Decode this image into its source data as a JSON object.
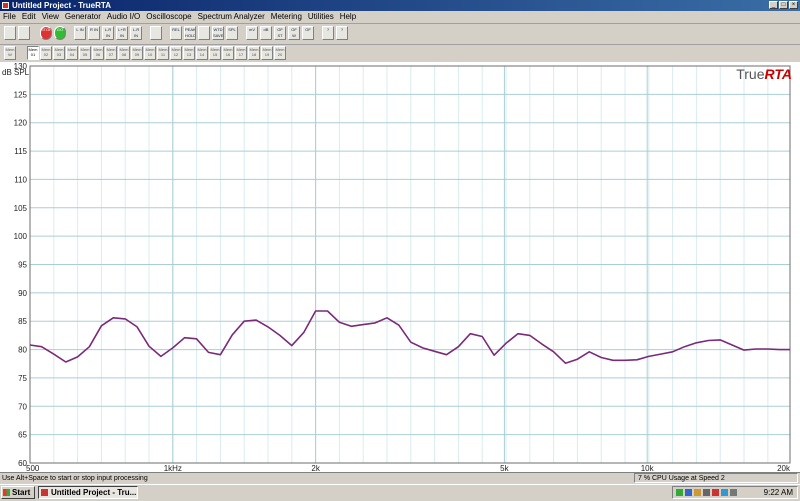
{
  "window": {
    "title": "Untitled Project - TrueRTA"
  },
  "menu": [
    "File",
    "Edit",
    "View",
    "Generator",
    "Audio I/O",
    "Oscilloscope",
    "Spectrum Analyzer",
    "Metering",
    "Utilities",
    "Help"
  ],
  "toolbar": [
    {
      "name": "sine-wave-tool",
      "label": ""
    },
    {
      "name": "spectrum-tool",
      "label": ""
    },
    {
      "name": "stop-tool",
      "label": "STOP"
    },
    {
      "name": "go-tool",
      "label": "GO"
    },
    {
      "name": "left-in-tool",
      "label": "L IN"
    },
    {
      "name": "right-in-tool",
      "label": "R IN"
    },
    {
      "name": "lr-in-tool",
      "label": "L-R IN"
    },
    {
      "name": "lplusr-in-tool",
      "label": "L+R IN"
    },
    {
      "name": "l-r-in-tool",
      "label": "L-R IN"
    },
    {
      "name": "grid-tool",
      "label": ""
    },
    {
      "name": "rel-tool",
      "label": "REL"
    },
    {
      "name": "peak-hold-tool",
      "label": "PEAK HOLD"
    },
    {
      "name": "bars-tool",
      "label": ""
    },
    {
      "name": "wtd-tool",
      "label": "WTD SAVE"
    },
    {
      "name": "spl-tool",
      "label": "SPL"
    },
    {
      "name": "mv-tool",
      "label": "mV"
    },
    {
      "name": "db-tool",
      "label": "dB"
    },
    {
      "name": "ofs-tool",
      "label": "OF ST"
    },
    {
      "name": "ofw-tool",
      "label": "OF W"
    },
    {
      "name": "of-tool",
      "label": "OF"
    },
    {
      "name": "info-tool",
      "label": "?"
    },
    {
      "name": "help-tool",
      "label": "?"
    }
  ],
  "memory_buttons": [
    "Mem W",
    "Mem 01",
    "Mem 02",
    "Mem 03",
    "Mem 04",
    "Mem 05",
    "Mem 06",
    "Mem 07",
    "Mem 08",
    "Mem 09",
    "Mem 10",
    "Mem 11",
    "Mem 12",
    "Mem 13",
    "Mem 14",
    "Mem 15",
    "Mem 16",
    "Mem 17",
    "Mem 18",
    "Mem 19",
    "Mem 20"
  ],
  "brand": {
    "part1": "True",
    "part2": "RTA"
  },
  "status": {
    "hint": "Use Alt+Space to start or stop input processing",
    "cpu": "7 % CPU Usage at Speed 2"
  },
  "taskbar": {
    "start": "Start",
    "task": "Untitled Project - Tru...",
    "clock": "9:22 AM"
  },
  "colors": {
    "trace": "#7a2a7a",
    "grid_major": "#a9cfd4",
    "grid_minor": "#d9ecee"
  },
  "chart_data": {
    "type": "line",
    "ylabel": "dB SPL",
    "ylim": [
      60,
      130
    ],
    "yticks": [
      60,
      65,
      70,
      75,
      80,
      85,
      90,
      95,
      100,
      105,
      110,
      115,
      120,
      125,
      130
    ],
    "xscale": "log",
    "xlim": [
      500,
      20000
    ],
    "xtick_labels": [
      {
        "freq": 500,
        "label": "500"
      },
      {
        "freq": 1000,
        "label": "1kHz"
      },
      {
        "freq": 2000,
        "label": "2k"
      },
      {
        "freq": 5000,
        "label": "5k"
      },
      {
        "freq": 10000,
        "label": "10k"
      },
      {
        "freq": 20000,
        "label": "20k"
      }
    ],
    "grid": true,
    "series": [
      {
        "x": [
          500,
          529,
          561,
          595,
          630,
          667,
          707,
          749,
          794,
          841,
          891,
          944,
          1000,
          1059,
          1122,
          1189,
          1260,
          1335,
          1414,
          1498,
          1587,
          1682,
          1782,
          1888,
          2000,
          2119,
          2245,
          2378,
          2520,
          2670,
          2828,
          2997,
          3175,
          3364,
          3564,
          3776,
          4000,
          4238,
          4490,
          4757,
          5040,
          5339,
          5657,
          5993,
          6350,
          6727,
          7127,
          7551,
          8000,
          8476,
          8980,
          9514,
          10079,
          10679,
          11314,
          11986,
          12699,
          13454,
          14254,
          15102,
          16000,
          16951,
          17959,
          19027,
          20000
        ],
        "y": [
          80.8,
          80.5,
          79.2,
          77.8,
          78.7,
          80.5,
          84.2,
          85.6,
          85.4,
          84.0,
          80.6,
          78.8,
          80.3,
          82.1,
          81.9,
          79.5,
          79.1,
          82.6,
          85.0,
          85.2,
          84.0,
          82.5,
          80.7,
          83.0,
          86.8,
          86.8,
          84.8,
          84.1,
          84.4,
          84.7,
          85.6,
          84.3,
          81.3,
          80.3,
          79.7,
          79.1,
          80.5,
          82.8,
          82.3,
          79.0,
          81.1,
          82.8,
          82.5,
          81.0,
          79.6,
          77.6,
          78.3,
          79.6,
          78.6,
          78.1,
          78.1,
          78.2,
          78.8,
          79.2,
          79.6,
          80.5,
          81.2,
          81.6,
          81.7,
          80.8,
          79.9,
          80.1,
          80.1,
          80.0,
          80.0
        ]
      }
    ]
  }
}
